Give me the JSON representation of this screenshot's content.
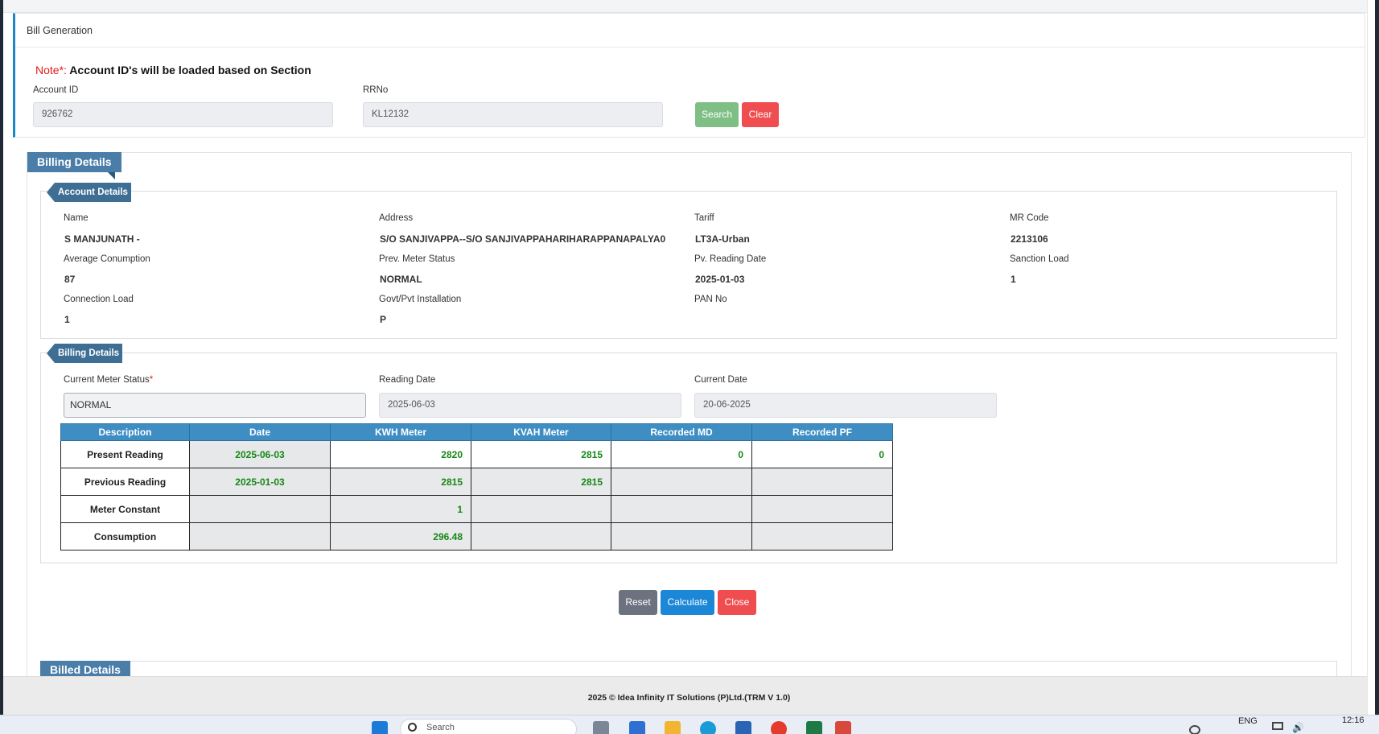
{
  "page": {
    "title": "Bill Generation"
  },
  "search": {
    "note_prefix": "Note*:",
    "note_text": " Account ID's will be loaded based on Section",
    "account_label": "Account ID",
    "account_value": "926762",
    "rrno_label": "RRNo",
    "rrno_value": "KL12132",
    "search_label": "Search",
    "clear_label": "Clear"
  },
  "billing_section": {
    "title": "Billing Details"
  },
  "account_details": {
    "legend": "Account Details",
    "fields": [
      {
        "label": "Name",
        "value": "S MANJUNATH -"
      },
      {
        "label": "Address",
        "value": "S/O SANJIVAPPA--S/O SANJIVAPPAHARIHARAPPANAPALYA0"
      },
      {
        "label": "Tariff",
        "value": "LT3A-Urban"
      },
      {
        "label": "MR Code",
        "value": "2213106"
      },
      {
        "label": "Average Conumption",
        "value": "87"
      },
      {
        "label": "Prev. Meter Status",
        "value": "NORMAL"
      },
      {
        "label": "Pv. Reading Date",
        "value": "2025-01-03"
      },
      {
        "label": "Sanction Load",
        "value": "1"
      },
      {
        "label": "Connection Load",
        "value": "1"
      },
      {
        "label": "Govt/Pvt Installation",
        "value": "P"
      },
      {
        "label": "PAN No",
        "value": ""
      }
    ]
  },
  "billing_details": {
    "legend": "Billing Details",
    "meter_status_label": "Current Meter Status",
    "required_mark": "*",
    "meter_status_value": "NORMAL",
    "reading_date_label": "Reading Date",
    "reading_date_value": "2025-06-03",
    "current_date_label": "Current Date",
    "current_date_value": "20-06-2025"
  },
  "readings": {
    "headers": [
      "Description",
      "Date",
      "KWH Meter",
      "KVAH Meter",
      "Recorded MD",
      "Recorded PF"
    ],
    "rows": [
      {
        "description": "Present Reading",
        "date": "2025-06-03",
        "kwh": "2820",
        "kvah": "2815",
        "md": "0",
        "pf": "0"
      },
      {
        "description": "Previous Reading",
        "date": "2025-01-03",
        "kwh": "2815",
        "kvah": "2815",
        "md": "",
        "pf": ""
      },
      {
        "description": "Meter Constant",
        "date": "",
        "kwh": "1",
        "kvah": "",
        "md": "",
        "pf": ""
      },
      {
        "description": "Consumption",
        "date": "",
        "kwh": "296.48",
        "kvah": "",
        "md": "",
        "pf": ""
      }
    ]
  },
  "actions": {
    "reset_label": "Reset",
    "calculate_label": "Calculate",
    "close_label": "Close"
  },
  "billed_details": {
    "legend": "Billed Details"
  },
  "footer": {
    "text": "2025 © Idea Infinity IT Solutions (P)Ltd.(TRM V 1.0)"
  },
  "taskbar": {
    "search_placeholder": "Search",
    "lang": "ENG",
    "time": "12:16",
    "apps": [
      "start-icon",
      "search-icon",
      "file-explorer-icon",
      "edge-icon",
      "store-icon",
      "chrome-icon",
      "excel-icon",
      "snipping-icon"
    ]
  },
  "colors": {
    "primary": "#1b87c9",
    "success": "#7fbf86",
    "danger": "#ef4d4f",
    "secondary": "#6c757d",
    "legend": "#4a7da8",
    "table_header": "#3e8ec4",
    "value_green": "#178717"
  }
}
